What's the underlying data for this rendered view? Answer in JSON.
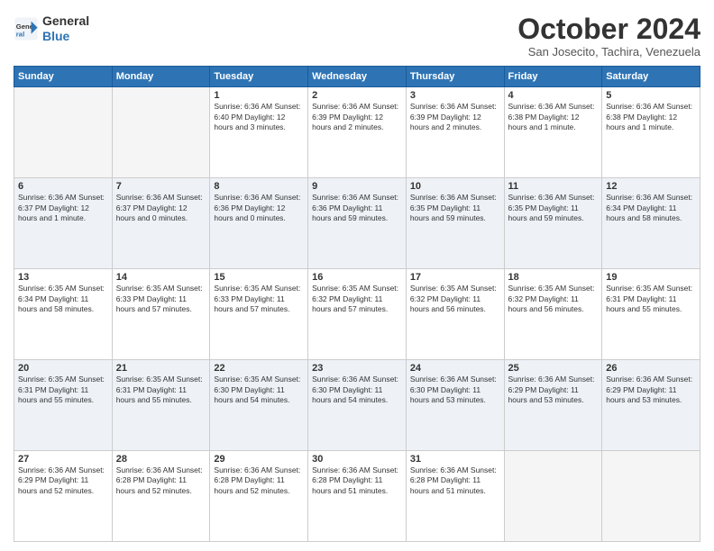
{
  "logo": {
    "line1": "General",
    "line2": "Blue"
  },
  "title": "October 2024",
  "subtitle": "San Josecito, Tachira, Venezuela",
  "days_header": [
    "Sunday",
    "Monday",
    "Tuesday",
    "Wednesday",
    "Thursday",
    "Friday",
    "Saturday"
  ],
  "weeks": [
    [
      {
        "day": "",
        "info": ""
      },
      {
        "day": "",
        "info": ""
      },
      {
        "day": "1",
        "info": "Sunrise: 6:36 AM\nSunset: 6:40 PM\nDaylight: 12 hours\nand 3 minutes."
      },
      {
        "day": "2",
        "info": "Sunrise: 6:36 AM\nSunset: 6:39 PM\nDaylight: 12 hours\nand 2 minutes."
      },
      {
        "day": "3",
        "info": "Sunrise: 6:36 AM\nSunset: 6:39 PM\nDaylight: 12 hours\nand 2 minutes."
      },
      {
        "day": "4",
        "info": "Sunrise: 6:36 AM\nSunset: 6:38 PM\nDaylight: 12 hours\nand 1 minute."
      },
      {
        "day": "5",
        "info": "Sunrise: 6:36 AM\nSunset: 6:38 PM\nDaylight: 12 hours\nand 1 minute."
      }
    ],
    [
      {
        "day": "6",
        "info": "Sunrise: 6:36 AM\nSunset: 6:37 PM\nDaylight: 12 hours\nand 1 minute."
      },
      {
        "day": "7",
        "info": "Sunrise: 6:36 AM\nSunset: 6:37 PM\nDaylight: 12 hours\nand 0 minutes."
      },
      {
        "day": "8",
        "info": "Sunrise: 6:36 AM\nSunset: 6:36 PM\nDaylight: 12 hours\nand 0 minutes."
      },
      {
        "day": "9",
        "info": "Sunrise: 6:36 AM\nSunset: 6:36 PM\nDaylight: 11 hours\nand 59 minutes."
      },
      {
        "day": "10",
        "info": "Sunrise: 6:36 AM\nSunset: 6:35 PM\nDaylight: 11 hours\nand 59 minutes."
      },
      {
        "day": "11",
        "info": "Sunrise: 6:36 AM\nSunset: 6:35 PM\nDaylight: 11 hours\nand 59 minutes."
      },
      {
        "day": "12",
        "info": "Sunrise: 6:36 AM\nSunset: 6:34 PM\nDaylight: 11 hours\nand 58 minutes."
      }
    ],
    [
      {
        "day": "13",
        "info": "Sunrise: 6:35 AM\nSunset: 6:34 PM\nDaylight: 11 hours\nand 58 minutes."
      },
      {
        "day": "14",
        "info": "Sunrise: 6:35 AM\nSunset: 6:33 PM\nDaylight: 11 hours\nand 57 minutes."
      },
      {
        "day": "15",
        "info": "Sunrise: 6:35 AM\nSunset: 6:33 PM\nDaylight: 11 hours\nand 57 minutes."
      },
      {
        "day": "16",
        "info": "Sunrise: 6:35 AM\nSunset: 6:32 PM\nDaylight: 11 hours\nand 57 minutes."
      },
      {
        "day": "17",
        "info": "Sunrise: 6:35 AM\nSunset: 6:32 PM\nDaylight: 11 hours\nand 56 minutes."
      },
      {
        "day": "18",
        "info": "Sunrise: 6:35 AM\nSunset: 6:32 PM\nDaylight: 11 hours\nand 56 minutes."
      },
      {
        "day": "19",
        "info": "Sunrise: 6:35 AM\nSunset: 6:31 PM\nDaylight: 11 hours\nand 55 minutes."
      }
    ],
    [
      {
        "day": "20",
        "info": "Sunrise: 6:35 AM\nSunset: 6:31 PM\nDaylight: 11 hours\nand 55 minutes."
      },
      {
        "day": "21",
        "info": "Sunrise: 6:35 AM\nSunset: 6:31 PM\nDaylight: 11 hours\nand 55 minutes."
      },
      {
        "day": "22",
        "info": "Sunrise: 6:35 AM\nSunset: 6:30 PM\nDaylight: 11 hours\nand 54 minutes."
      },
      {
        "day": "23",
        "info": "Sunrise: 6:36 AM\nSunset: 6:30 PM\nDaylight: 11 hours\nand 54 minutes."
      },
      {
        "day": "24",
        "info": "Sunrise: 6:36 AM\nSunset: 6:30 PM\nDaylight: 11 hours\nand 53 minutes."
      },
      {
        "day": "25",
        "info": "Sunrise: 6:36 AM\nSunset: 6:29 PM\nDaylight: 11 hours\nand 53 minutes."
      },
      {
        "day": "26",
        "info": "Sunrise: 6:36 AM\nSunset: 6:29 PM\nDaylight: 11 hours\nand 53 minutes."
      }
    ],
    [
      {
        "day": "27",
        "info": "Sunrise: 6:36 AM\nSunset: 6:29 PM\nDaylight: 11 hours\nand 52 minutes."
      },
      {
        "day": "28",
        "info": "Sunrise: 6:36 AM\nSunset: 6:28 PM\nDaylight: 11 hours\nand 52 minutes."
      },
      {
        "day": "29",
        "info": "Sunrise: 6:36 AM\nSunset: 6:28 PM\nDaylight: 11 hours\nand 52 minutes."
      },
      {
        "day": "30",
        "info": "Sunrise: 6:36 AM\nSunset: 6:28 PM\nDaylight: 11 hours\nand 51 minutes."
      },
      {
        "day": "31",
        "info": "Sunrise: 6:36 AM\nSunset: 6:28 PM\nDaylight: 11 hours\nand 51 minutes."
      },
      {
        "day": "",
        "info": ""
      },
      {
        "day": "",
        "info": ""
      }
    ]
  ]
}
